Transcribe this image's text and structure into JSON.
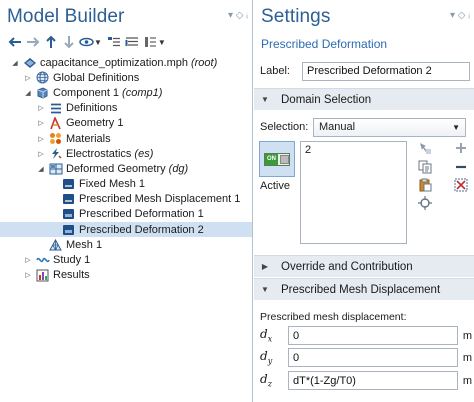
{
  "model_builder": {
    "title": "Model Builder",
    "tree": [
      {
        "label": "capacitance_optimization.mph",
        "tag": "(root)",
        "depth": 0,
        "twisty": "open",
        "icon": "model-root-icon"
      },
      {
        "label": "Global Definitions",
        "tag": "",
        "depth": 1,
        "twisty": "closed",
        "icon": "globe-icon"
      },
      {
        "label": "Component 1",
        "tag": "(comp1)",
        "depth": 1,
        "twisty": "open",
        "icon": "component-icon"
      },
      {
        "label": "Definitions",
        "tag": "",
        "depth": 2,
        "twisty": "closed",
        "icon": "definitions-icon"
      },
      {
        "label": "Geometry 1",
        "tag": "",
        "depth": 2,
        "twisty": "closed",
        "icon": "geometry-icon"
      },
      {
        "label": "Materials",
        "tag": "",
        "depth": 2,
        "twisty": "closed",
        "icon": "materials-icon"
      },
      {
        "label": "Electrostatics",
        "tag": "(es)",
        "depth": 2,
        "twisty": "closed",
        "icon": "electrostatics-icon"
      },
      {
        "label": "Deformed Geometry",
        "tag": "(dg)",
        "depth": 2,
        "twisty": "open",
        "icon": "deformed-geometry-icon"
      },
      {
        "label": "Fixed Mesh 1",
        "tag": "",
        "depth": 3,
        "twisty": "",
        "icon": "boundary-condition-icon"
      },
      {
        "label": "Prescribed Mesh Displacement 1",
        "tag": "",
        "depth": 3,
        "twisty": "",
        "icon": "boundary-condition-icon"
      },
      {
        "label": "Prescribed Deformation 1",
        "tag": "",
        "depth": 3,
        "twisty": "",
        "icon": "domain-condition-icon"
      },
      {
        "label": "Prescribed Deformation 2",
        "tag": "",
        "depth": 3,
        "twisty": "",
        "icon": "domain-condition-icon",
        "selected": true
      },
      {
        "label": "Mesh 1",
        "tag": "",
        "depth": 2,
        "twisty": "",
        "icon": "mesh-icon"
      },
      {
        "label": "Study 1",
        "tag": "",
        "depth": 1,
        "twisty": "closed",
        "icon": "study-icon"
      },
      {
        "label": "Results",
        "tag": "",
        "depth": 1,
        "twisty": "closed",
        "icon": "results-icon"
      }
    ]
  },
  "settings": {
    "title": "Settings",
    "subtitle": "Prescribed Deformation",
    "label_key": "Label:",
    "label_value": "Prescribed Deformation 2",
    "domain_selection_header": "Domain Selection",
    "selection_key": "Selection:",
    "selection_value": "Manual",
    "toggle_text": "ON",
    "active_label": "Active",
    "selected_domains": "2",
    "override_header": "Override and Contribution",
    "pmd_header": "Prescribed Mesh Displacement",
    "prompt": "Prescribed mesh displacement:",
    "rows": [
      {
        "sym": "d",
        "sub": "x",
        "value": "0",
        "unit": "m"
      },
      {
        "sym": "d",
        "sub": "y",
        "value": "0",
        "unit": "m"
      },
      {
        "sym": "d",
        "sub": "z",
        "value": "dT*(1-Zg/T0)",
        "unit": "m"
      }
    ]
  },
  "colors": {
    "title_blue": "#2c5f94",
    "selection_bg": "#cfe0f3",
    "section_bg": "#e6ebf1"
  }
}
